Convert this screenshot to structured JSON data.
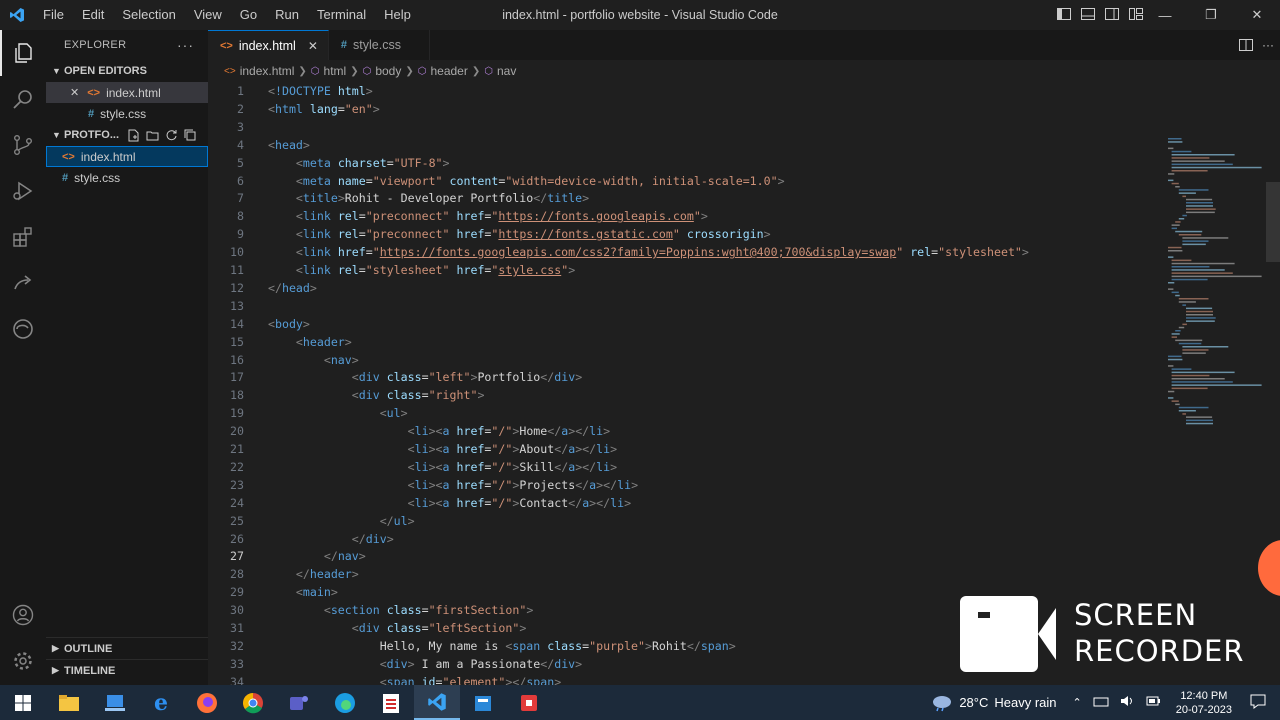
{
  "titlebar": {
    "menus": [
      "File",
      "Edit",
      "Selection",
      "View",
      "Go",
      "Run",
      "Terminal",
      "Help"
    ],
    "title": "index.html - portfolio website - Visual Studio Code"
  },
  "sidebar": {
    "title": "EXPLORER",
    "open_editors_label": "OPEN EDITORS",
    "open_editors": [
      {
        "name": "index.html",
        "type": "html"
      },
      {
        "name": "style.css",
        "type": "css"
      }
    ],
    "folder_label": "PROTFO...",
    "files": [
      {
        "name": "index.html",
        "type": "html"
      },
      {
        "name": "style.css",
        "type": "css"
      }
    ],
    "outline_label": "OUTLINE",
    "timeline_label": "TIMELINE"
  },
  "tabs": [
    {
      "name": "index.html",
      "type": "html"
    },
    {
      "name": "style.css",
      "type": "css"
    }
  ],
  "breadcrumb": [
    "index.html",
    "html",
    "body",
    "header",
    "nav"
  ],
  "editor": {
    "current_line": 27,
    "lines": [
      [
        1,
        "",
        [
          [
            "t",
            "<"
          ],
          [
            "tg",
            "!DOCTYPE"
          ],
          [
            "tx",
            " "
          ],
          [
            "at",
            "html"
          ],
          [
            "t",
            ">"
          ]
        ]
      ],
      [
        2,
        "",
        [
          [
            "t",
            "<"
          ],
          [
            "tg",
            "html"
          ],
          [
            "tx",
            " "
          ],
          [
            "at",
            "lang"
          ],
          [
            "tx",
            "="
          ],
          [
            "st",
            "\"en\""
          ],
          [
            "t",
            ">"
          ]
        ]
      ],
      [
        3,
        "",
        []
      ],
      [
        4,
        "",
        [
          [
            "t",
            "<"
          ],
          [
            "tg",
            "head"
          ],
          [
            "t",
            ">"
          ]
        ]
      ],
      [
        5,
        "    ",
        [
          [
            "t",
            "<"
          ],
          [
            "tg",
            "meta"
          ],
          [
            "tx",
            " "
          ],
          [
            "at",
            "charset"
          ],
          [
            "tx",
            "="
          ],
          [
            "st",
            "\"UTF-8\""
          ],
          [
            "t",
            ">"
          ]
        ]
      ],
      [
        6,
        "    ",
        [
          [
            "t",
            "<"
          ],
          [
            "tg",
            "meta"
          ],
          [
            "tx",
            " "
          ],
          [
            "at",
            "name"
          ],
          [
            "tx",
            "="
          ],
          [
            "st",
            "\"viewport\""
          ],
          [
            "tx",
            " "
          ],
          [
            "at",
            "content"
          ],
          [
            "tx",
            "="
          ],
          [
            "st",
            "\"width=device-width, initial-scale=1.0\""
          ],
          [
            "t",
            ">"
          ]
        ]
      ],
      [
        7,
        "    ",
        [
          [
            "t",
            "<"
          ],
          [
            "tg",
            "title"
          ],
          [
            "t",
            ">"
          ],
          [
            "tx",
            "Rohit - Developer Portfolio"
          ],
          [
            "t",
            "</"
          ],
          [
            "tg",
            "title"
          ],
          [
            "t",
            ">"
          ]
        ]
      ],
      [
        8,
        "    ",
        [
          [
            "t",
            "<"
          ],
          [
            "tg",
            "link"
          ],
          [
            "tx",
            " "
          ],
          [
            "at",
            "rel"
          ],
          [
            "tx",
            "="
          ],
          [
            "st",
            "\"preconnect\""
          ],
          [
            "tx",
            " "
          ],
          [
            "at",
            "href"
          ],
          [
            "tx",
            "="
          ],
          [
            "st",
            "\""
          ],
          [
            "stu",
            "https://fonts.googleapis.com"
          ],
          [
            "st",
            "\""
          ],
          [
            "t",
            ">"
          ]
        ]
      ],
      [
        9,
        "    ",
        [
          [
            "t",
            "<"
          ],
          [
            "tg",
            "link"
          ],
          [
            "tx",
            " "
          ],
          [
            "at",
            "rel"
          ],
          [
            "tx",
            "="
          ],
          [
            "st",
            "\"preconnect\""
          ],
          [
            "tx",
            " "
          ],
          [
            "at",
            "href"
          ],
          [
            "tx",
            "="
          ],
          [
            "st",
            "\""
          ],
          [
            "stu",
            "https://fonts.gstatic.com"
          ],
          [
            "st",
            "\""
          ],
          [
            "tx",
            " "
          ],
          [
            "at",
            "crossorigin"
          ],
          [
            "t",
            ">"
          ]
        ]
      ],
      [
        10,
        "    ",
        [
          [
            "t",
            "<"
          ],
          [
            "tg",
            "link"
          ],
          [
            "tx",
            " "
          ],
          [
            "at",
            "href"
          ],
          [
            "tx",
            "="
          ],
          [
            "st",
            "\""
          ],
          [
            "stu",
            "https://fonts.googleapis.com/css2?family=Poppins:wght@400;700&display=swap"
          ],
          [
            "st",
            "\""
          ],
          [
            "tx",
            " "
          ],
          [
            "at",
            "rel"
          ],
          [
            "tx",
            "="
          ],
          [
            "st",
            "\"stylesheet\""
          ],
          [
            "t",
            ">"
          ]
        ]
      ],
      [
        11,
        "    ",
        [
          [
            "t",
            "<"
          ],
          [
            "tg",
            "link"
          ],
          [
            "tx",
            " "
          ],
          [
            "at",
            "rel"
          ],
          [
            "tx",
            "="
          ],
          [
            "st",
            "\"stylesheet\""
          ],
          [
            "tx",
            " "
          ],
          [
            "at",
            "href"
          ],
          [
            "tx",
            "="
          ],
          [
            "st",
            "\""
          ],
          [
            "stu",
            "style.css"
          ],
          [
            "st",
            "\""
          ],
          [
            "t",
            ">"
          ]
        ]
      ],
      [
        12,
        "",
        [
          [
            "t",
            "</"
          ],
          [
            "tg",
            "head"
          ],
          [
            "t",
            ">"
          ]
        ]
      ],
      [
        13,
        "",
        []
      ],
      [
        14,
        "",
        [
          [
            "t",
            "<"
          ],
          [
            "tg",
            "body"
          ],
          [
            "t",
            ">"
          ]
        ]
      ],
      [
        15,
        "    ",
        [
          [
            "t",
            "<"
          ],
          [
            "tg",
            "header"
          ],
          [
            "t",
            ">"
          ]
        ]
      ],
      [
        16,
        "        ",
        [
          [
            "t",
            "<"
          ],
          [
            "tg",
            "nav"
          ],
          [
            "t",
            ">"
          ]
        ]
      ],
      [
        17,
        "            ",
        [
          [
            "t",
            "<"
          ],
          [
            "tg",
            "div"
          ],
          [
            "tx",
            " "
          ],
          [
            "at",
            "class"
          ],
          [
            "tx",
            "="
          ],
          [
            "st",
            "\"left\""
          ],
          [
            "t",
            ">"
          ],
          [
            "tx",
            "Portfolio"
          ],
          [
            "t",
            "</"
          ],
          [
            "tg",
            "div"
          ],
          [
            "t",
            ">"
          ]
        ]
      ],
      [
        18,
        "            ",
        [
          [
            "t",
            "<"
          ],
          [
            "tg",
            "div"
          ],
          [
            "tx",
            " "
          ],
          [
            "at",
            "class"
          ],
          [
            "tx",
            "="
          ],
          [
            "st",
            "\"right\""
          ],
          [
            "t",
            ">"
          ]
        ]
      ],
      [
        19,
        "                ",
        [
          [
            "t",
            "<"
          ],
          [
            "tg",
            "ul"
          ],
          [
            "t",
            ">"
          ]
        ]
      ],
      [
        20,
        "                    ",
        [
          [
            "t",
            "<"
          ],
          [
            "tg",
            "li"
          ],
          [
            "t",
            "><"
          ],
          [
            "tg",
            "a"
          ],
          [
            "tx",
            " "
          ],
          [
            "at",
            "href"
          ],
          [
            "tx",
            "="
          ],
          [
            "st",
            "\"/\""
          ],
          [
            "t",
            ">"
          ],
          [
            "tx",
            "Home"
          ],
          [
            "t",
            "</"
          ],
          [
            "tg",
            "a"
          ],
          [
            "t",
            "></"
          ],
          [
            "tg",
            "li"
          ],
          [
            "t",
            ">"
          ]
        ]
      ],
      [
        21,
        "                    ",
        [
          [
            "t",
            "<"
          ],
          [
            "tg",
            "li"
          ],
          [
            "t",
            "><"
          ],
          [
            "tg",
            "a"
          ],
          [
            "tx",
            " "
          ],
          [
            "at",
            "href"
          ],
          [
            "tx",
            "="
          ],
          [
            "st",
            "\"/\""
          ],
          [
            "t",
            ">"
          ],
          [
            "tx",
            "About"
          ],
          [
            "t",
            "</"
          ],
          [
            "tg",
            "a"
          ],
          [
            "t",
            "></"
          ],
          [
            "tg",
            "li"
          ],
          [
            "t",
            ">"
          ]
        ]
      ],
      [
        22,
        "                    ",
        [
          [
            "t",
            "<"
          ],
          [
            "tg",
            "li"
          ],
          [
            "t",
            "><"
          ],
          [
            "tg",
            "a"
          ],
          [
            "tx",
            " "
          ],
          [
            "at",
            "href"
          ],
          [
            "tx",
            "="
          ],
          [
            "st",
            "\"/\""
          ],
          [
            "t",
            ">"
          ],
          [
            "tx",
            "Skill"
          ],
          [
            "t",
            "</"
          ],
          [
            "tg",
            "a"
          ],
          [
            "t",
            "></"
          ],
          [
            "tg",
            "li"
          ],
          [
            "t",
            ">"
          ]
        ]
      ],
      [
        23,
        "                    ",
        [
          [
            "t",
            "<"
          ],
          [
            "tg",
            "li"
          ],
          [
            "t",
            "><"
          ],
          [
            "tg",
            "a"
          ],
          [
            "tx",
            " "
          ],
          [
            "at",
            "href"
          ],
          [
            "tx",
            "="
          ],
          [
            "st",
            "\"/\""
          ],
          [
            "t",
            ">"
          ],
          [
            "tx",
            "Projects"
          ],
          [
            "t",
            "</"
          ],
          [
            "tg",
            "a"
          ],
          [
            "t",
            "></"
          ],
          [
            "tg",
            "li"
          ],
          [
            "t",
            ">"
          ]
        ]
      ],
      [
        24,
        "                    ",
        [
          [
            "t",
            "<"
          ],
          [
            "tg",
            "li"
          ],
          [
            "t",
            "><"
          ],
          [
            "tg",
            "a"
          ],
          [
            "tx",
            " "
          ],
          [
            "at",
            "href"
          ],
          [
            "tx",
            "="
          ],
          [
            "st",
            "\"/\""
          ],
          [
            "t",
            ">"
          ],
          [
            "tx",
            "Contact"
          ],
          [
            "t",
            "</"
          ],
          [
            "tg",
            "a"
          ],
          [
            "t",
            "></"
          ],
          [
            "tg",
            "li"
          ],
          [
            "t",
            ">"
          ]
        ]
      ],
      [
        25,
        "                ",
        [
          [
            "t",
            "</"
          ],
          [
            "tg",
            "ul"
          ],
          [
            "t",
            ">"
          ]
        ]
      ],
      [
        26,
        "            ",
        [
          [
            "t",
            "</"
          ],
          [
            "tg",
            "div"
          ],
          [
            "t",
            ">"
          ]
        ]
      ],
      [
        27,
        "        ",
        [
          [
            "t",
            "</"
          ],
          [
            "tg",
            "nav"
          ],
          [
            "t",
            ">"
          ]
        ]
      ],
      [
        28,
        "    ",
        [
          [
            "t",
            "</"
          ],
          [
            "tg",
            "header"
          ],
          [
            "t",
            ">"
          ]
        ]
      ],
      [
        29,
        "    ",
        [
          [
            "t",
            "<"
          ],
          [
            "tg",
            "main"
          ],
          [
            "t",
            ">"
          ]
        ]
      ],
      [
        30,
        "        ",
        [
          [
            "t",
            "<"
          ],
          [
            "tg",
            "section"
          ],
          [
            "tx",
            " "
          ],
          [
            "at",
            "class"
          ],
          [
            "tx",
            "="
          ],
          [
            "st",
            "\"firstSection\""
          ],
          [
            "t",
            ">"
          ]
        ]
      ],
      [
        31,
        "            ",
        [
          [
            "t",
            "<"
          ],
          [
            "tg",
            "div"
          ],
          [
            "tx",
            " "
          ],
          [
            "at",
            "class"
          ],
          [
            "tx",
            "="
          ],
          [
            "st",
            "\"leftSection\""
          ],
          [
            "t",
            ">"
          ]
        ]
      ],
      [
        32,
        "                ",
        [
          [
            "tx",
            "Hello, My name is "
          ],
          [
            "t",
            "<"
          ],
          [
            "tg",
            "span"
          ],
          [
            "tx",
            " "
          ],
          [
            "at",
            "class"
          ],
          [
            "tx",
            "="
          ],
          [
            "st",
            "\"purple\""
          ],
          [
            "t",
            ">"
          ],
          [
            "tx",
            "Rohit"
          ],
          [
            "t",
            "</"
          ],
          [
            "tg",
            "span"
          ],
          [
            "t",
            ">"
          ]
        ]
      ],
      [
        33,
        "                ",
        [
          [
            "t",
            "<"
          ],
          [
            "tg",
            "div"
          ],
          [
            "t",
            ">"
          ],
          [
            "tx",
            " I am a Passionate"
          ],
          [
            "t",
            "</"
          ],
          [
            "tg",
            "div"
          ],
          [
            "t",
            ">"
          ]
        ]
      ],
      [
        34,
        "                ",
        [
          [
            "t",
            "<"
          ],
          [
            "tg",
            "span"
          ],
          [
            "tx",
            " "
          ],
          [
            "at",
            "id"
          ],
          [
            "tx",
            "="
          ],
          [
            "st",
            "\"element\""
          ],
          [
            "t",
            "></"
          ],
          [
            "tg",
            "span"
          ],
          [
            "t",
            ">"
          ]
        ]
      ]
    ]
  },
  "recorder": {
    "line1": "SCREEN",
    "line2": "RECORDER"
  },
  "taskbar": {
    "weather_temp": "28°C",
    "weather_text": "Heavy rain",
    "time": "12:40 PM",
    "date": "20-07-2023"
  },
  "colors": {
    "accent": "#0078d4",
    "tag": "#569cd6",
    "attr": "#9cdcfe",
    "string": "#ce9178",
    "bracket": "#808080"
  }
}
